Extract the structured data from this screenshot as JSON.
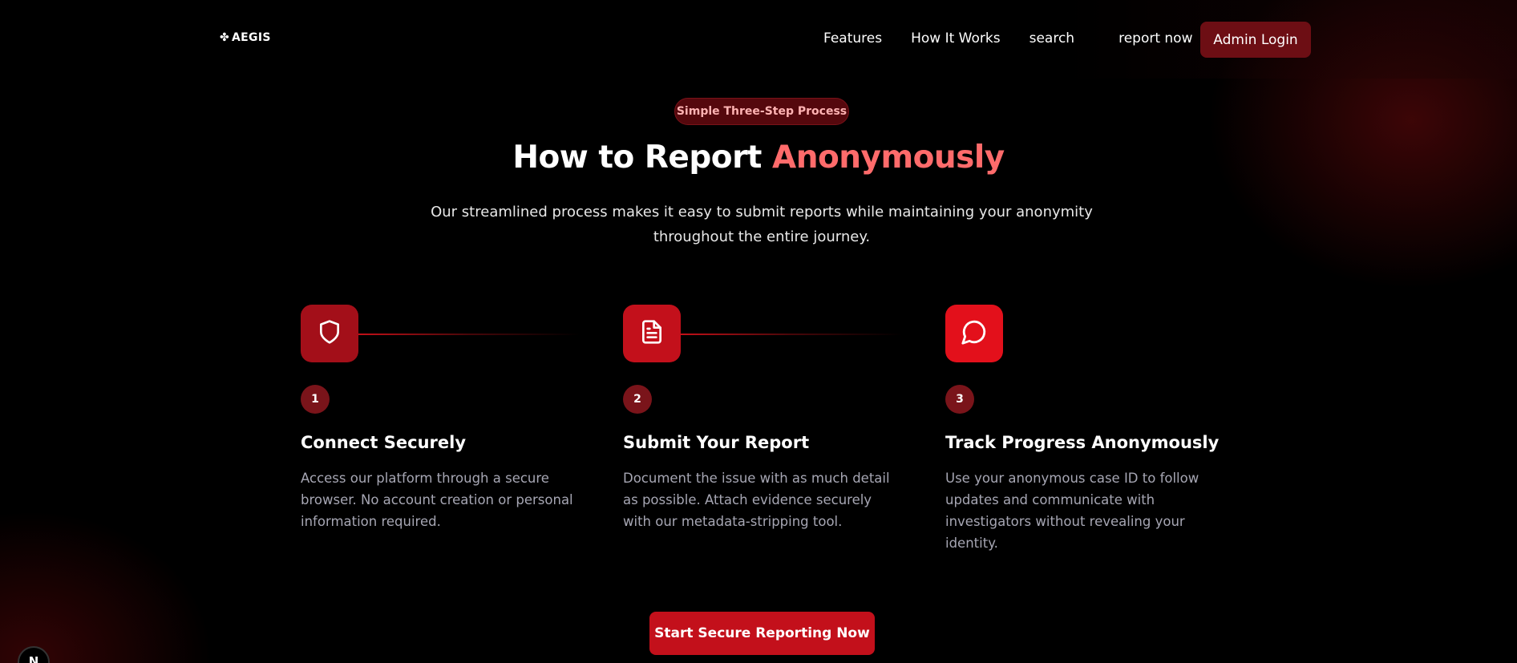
{
  "brand": {
    "logo_icon": "✤",
    "name": "AEGIS"
  },
  "nav": {
    "links": [
      "Features",
      "How It Works",
      "search",
      "report now"
    ],
    "admin_label": "Admin Login"
  },
  "hero": {
    "pill": "Simple Three-Step Process",
    "title_prefix": "How to Report ",
    "title_accent": "Anonymously",
    "subtitle": "Our streamlined process makes it easy to submit reports while maintaining your anonymity throughout the entire journey."
  },
  "steps": [
    {
      "icon": "shield-icon",
      "number": "1",
      "title": "Connect Securely",
      "description": "Access our platform through a secure browser. No account creation or personal information required."
    },
    {
      "icon": "document-icon",
      "number": "2",
      "title": "Submit Your Report",
      "description": "Document the issue with as much detail as possible. Attach evidence securely with our metadata-stripping tool."
    },
    {
      "icon": "chat-bubble-icon",
      "number": "3",
      "title": "Track Progress Anonymously",
      "description": "Use your anonymous case ID to follow updates and communicate with investigators without revealing your identity."
    }
  ],
  "cta": {
    "label": "Start Secure Reporting Now"
  },
  "dev_badge": {
    "letter": "N"
  },
  "colors": {
    "accent": "#ff6b6b",
    "primary_red": "#c3101b",
    "admin_button": "#6d0e14",
    "pill_bg": "#55080d"
  }
}
